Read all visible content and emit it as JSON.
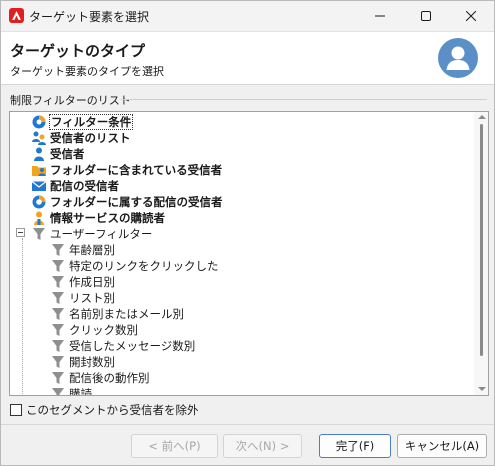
{
  "window": {
    "title": "ターゲット要素を選択",
    "app_icon": "adobe-campaign-icon",
    "controls": [
      "minimize-icon",
      "maximize-icon",
      "close-icon"
    ]
  },
  "header": {
    "title": "ターゲットのタイプ",
    "subtitle": "ターゲット要素のタイプを選択",
    "avatar_icon": "user-avatar-icon"
  },
  "section": {
    "label": "制限フィルターのリスト"
  },
  "tree": {
    "items": [
      {
        "label": "フィルター条件",
        "icon": "filter-conditions-icon",
        "bold": true,
        "selected": true
      },
      {
        "label": "受信者のリスト",
        "icon": "recipient-list-icon",
        "bold": true
      },
      {
        "label": "受信者",
        "icon": "recipient-icon",
        "bold": true
      },
      {
        "label": "フォルダーに含まれている受信者",
        "icon": "folder-recipient-icon",
        "bold": true
      },
      {
        "label": "配信の受信者",
        "icon": "delivery-envelope-icon",
        "bold": true
      },
      {
        "label": "フォルダーに属する配信の受信者",
        "icon": "delivery-folder-icon",
        "bold": true
      },
      {
        "label": "情報サービスの購読者",
        "icon": "subscriber-icon",
        "bold": true
      },
      {
        "label": "ユーザーフィルター",
        "icon": "funnel-icon",
        "bold": false,
        "expanded": true
      },
      {
        "label": "年齢層別",
        "icon": "funnel-icon",
        "bold": false
      },
      {
        "label": "特定のリンクをクリックした",
        "icon": "funnel-icon",
        "bold": false
      },
      {
        "label": "作成日別",
        "icon": "funnel-icon",
        "bold": false
      },
      {
        "label": "リスト別",
        "icon": "funnel-icon",
        "bold": false
      },
      {
        "label": "名前別またはメール別",
        "icon": "funnel-icon",
        "bold": false
      },
      {
        "label": "クリック数別",
        "icon": "funnel-icon",
        "bold": false
      },
      {
        "label": "受信したメッセージ数別",
        "icon": "funnel-icon",
        "bold": false
      },
      {
        "label": "開封数別",
        "icon": "funnel-icon",
        "bold": false
      },
      {
        "label": "配信後の動作別",
        "icon": "funnel-icon",
        "bold": false
      },
      {
        "label": "購読",
        "icon": "funnel-icon",
        "bold": false
      }
    ]
  },
  "exclude_checkbox": {
    "label": "このセグメントから受信者を除外",
    "checked": false
  },
  "buttons": {
    "prev": "< 前へ(P)",
    "next": "次へ(N) >",
    "finish": "完了(F)",
    "cancel": "キャンセル(A)"
  },
  "colors": {
    "brand_red": "#e02020",
    "icon_blue": "#1f78d1",
    "icon_orange": "#f2a41c",
    "funnel_gray": "#8f8f8f",
    "avatar_blue": "#5b8fc7"
  }
}
